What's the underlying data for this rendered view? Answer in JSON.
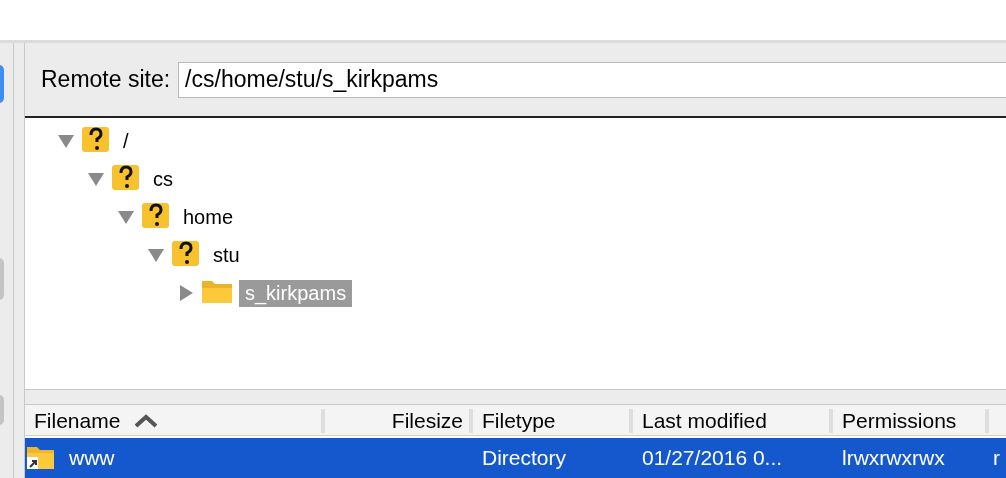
{
  "remote_site": {
    "label": "Remote site:",
    "value": "/cs/home/stu/s_kirkpams"
  },
  "tree": [
    {
      "label": "/",
      "kind": "unknown",
      "expanded": true,
      "selected": false,
      "children": [
        {
          "label": "cs",
          "kind": "unknown",
          "expanded": true,
          "selected": false,
          "children": [
            {
              "label": "home",
              "kind": "unknown",
              "expanded": true,
              "selected": false,
              "children": [
                {
                  "label": "stu",
                  "kind": "unknown",
                  "expanded": true,
                  "selected": false,
                  "children": [
                    {
                      "label": "s_kirkpams",
                      "kind": "folder",
                      "expanded": false,
                      "selected": true
                    }
                  ]
                }
              ]
            }
          ]
        }
      ]
    }
  ],
  "file_list": {
    "columns": [
      {
        "label": "Filename",
        "sorted": true
      },
      {
        "label": "Filesize",
        "sorted": false
      },
      {
        "label": "Filetype",
        "sorted": false
      },
      {
        "label": "Last modified",
        "sorted": false
      },
      {
        "label": "Permissions",
        "sorted": false
      }
    ],
    "rows": [
      {
        "kind": "link-folder",
        "selected": true,
        "cells": [
          "www",
          "",
          "Directory",
          "01/27/2016 0...",
          "lrwxrwxrwx",
          "r"
        ]
      }
    ]
  }
}
